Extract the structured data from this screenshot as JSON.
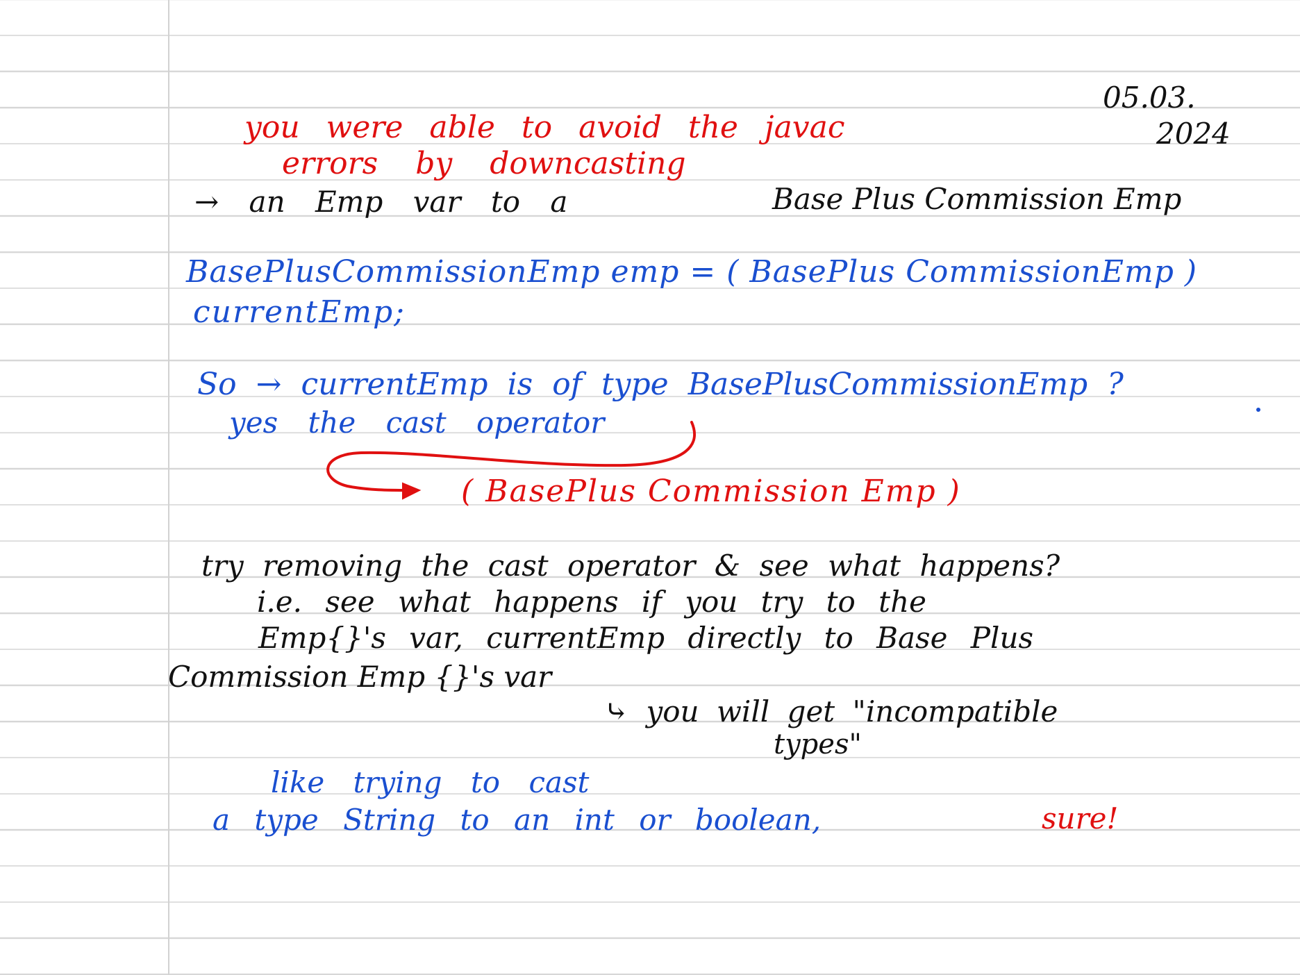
{
  "note": {
    "date_line1": "05.03.",
    "date_line2": "2024",
    "lines": [
      {
        "text": "you were able to avoid the javac",
        "color": "red"
      },
      {
        "text": "errors by downcasting",
        "color": "red"
      },
      {
        "text": "→  an  Emp  var  to  a",
        "color": "black"
      },
      {
        "text": "Base Plus Commission Emp",
        "color": "black"
      },
      {
        "text": "BasePlusCommissionEmp  emp  =  ( BasePlus CommissionEmp )",
        "color": "blue"
      },
      {
        "text": "currentEmp;",
        "color": "blue"
      },
      {
        "text": "So → currentEmp is of type BasePlusCommissionEmp ?",
        "color": "blue"
      },
      {
        "text": "yes  the  cast  operator",
        "color": "blue"
      },
      {
        "text": "( BasePlus Commission Emp )",
        "color": "red"
      },
      {
        "text": "try  removing  the  cast operator  &  see  what happens?",
        "color": "black"
      },
      {
        "text": "i.e.  see  what happens  if  you  try  to  the",
        "color": "black"
      },
      {
        "text": "Emp{}'s  var, currentEmp  directly  to  Base Plus",
        "color": "black"
      },
      {
        "text": "Commission Emp {}'s var",
        "color": "black"
      },
      {
        "text": "⤷  you  will get  \"incompatible",
        "color": "black"
      },
      {
        "text": "types\"",
        "color": "black"
      },
      {
        "text": "like  trying  to  cast",
        "color": "blue"
      },
      {
        "text": "a  type  String  to  an  int  or  boolean,",
        "color": "blue"
      },
      {
        "text": "sure!",
        "color": "red"
      }
    ]
  },
  "colors": {
    "red": "#e01010",
    "blue": "#1a4fd0",
    "black": "#111111",
    "rule": "#d6d6d6"
  }
}
